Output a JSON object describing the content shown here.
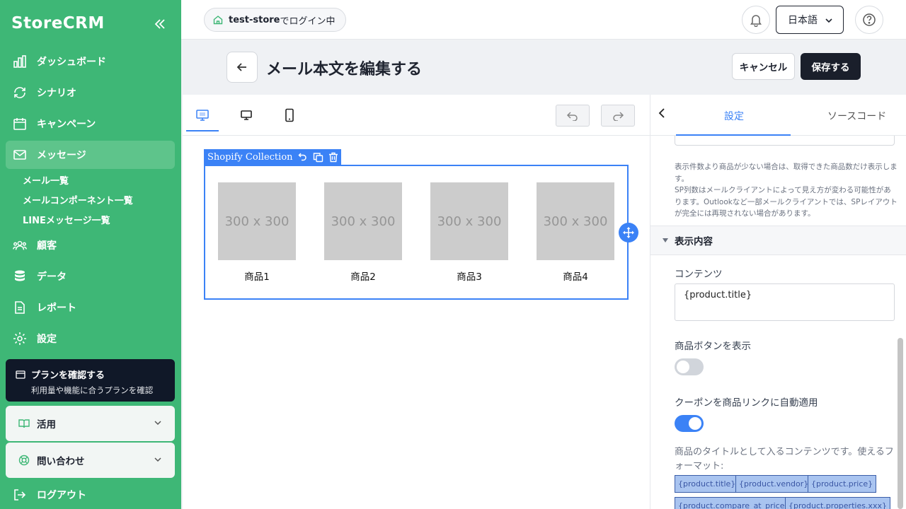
{
  "sidebar": {
    "logo": "StoreCRM",
    "nav": [
      {
        "label": "ダッシュボード",
        "icon": "bar-chart-icon"
      },
      {
        "label": "シナリオ",
        "icon": "refresh-icon"
      },
      {
        "label": "キャンペーン",
        "icon": "calendar-icon"
      },
      {
        "label": "メッセージ",
        "icon": "mail-icon",
        "active": true
      },
      {
        "label": "顧客",
        "icon": "users-icon"
      },
      {
        "label": "データ",
        "icon": "database-icon"
      },
      {
        "label": "レポート",
        "icon": "document-icon"
      },
      {
        "label": "設定",
        "icon": "gear-icon"
      }
    ],
    "subnav": [
      "メール一覧",
      "メールコンポーネント一覧",
      "LINEメッセージ一覧"
    ],
    "plan": {
      "title": "プランを確認する",
      "subtitle": "利用量や機能に合うプランを確認"
    },
    "accordions": [
      {
        "label": "活用",
        "icon": "book-icon"
      },
      {
        "label": "問い合わせ",
        "icon": "lifebuoy-icon"
      }
    ],
    "logout": "ログアウト"
  },
  "topbar": {
    "store": "test-store",
    "store_suffix": " でログイン中",
    "language": "日本語"
  },
  "header": {
    "title": "メール本文を編集する",
    "cancel_label": "キャンセル",
    "save_label": "保存する"
  },
  "editor": {
    "block_name": "Shopify Collection",
    "products": [
      {
        "placeholder": "300 x 300",
        "name": "商品1"
      },
      {
        "placeholder": "300 x 300",
        "name": "商品2"
      },
      {
        "placeholder": "300 x 300",
        "name": "商品3"
      },
      {
        "placeholder": "300 x 300",
        "name": "商品4"
      }
    ]
  },
  "panel": {
    "tabs": [
      "設定",
      "ソースコード"
    ],
    "note": "表示件数より商品が少ない場合は、取得できた商品数だけ表示します。\nSP列数はメールクライアントによって見え方が変わる可能性があります。Outlookなど一部メールクライアントでは、SPレイアウトが完全には再現されない場合があります。",
    "section": "表示内容",
    "content_label": "コンテンツ",
    "content_value": "{product.title}",
    "show_button_label": "商品ボタンを表示",
    "show_button_on": false,
    "coupon_label": "クーポンを商品リンクに自動適用",
    "coupon_on": true,
    "format_desc": "商品のタイトルとして入るコンテンツです。使えるフォーマット:",
    "formats": [
      "{product.title}",
      "{product.vendor}",
      "{product.price}",
      "{product.compare_at_price}",
      "{product.properties.xxx}"
    ]
  }
}
